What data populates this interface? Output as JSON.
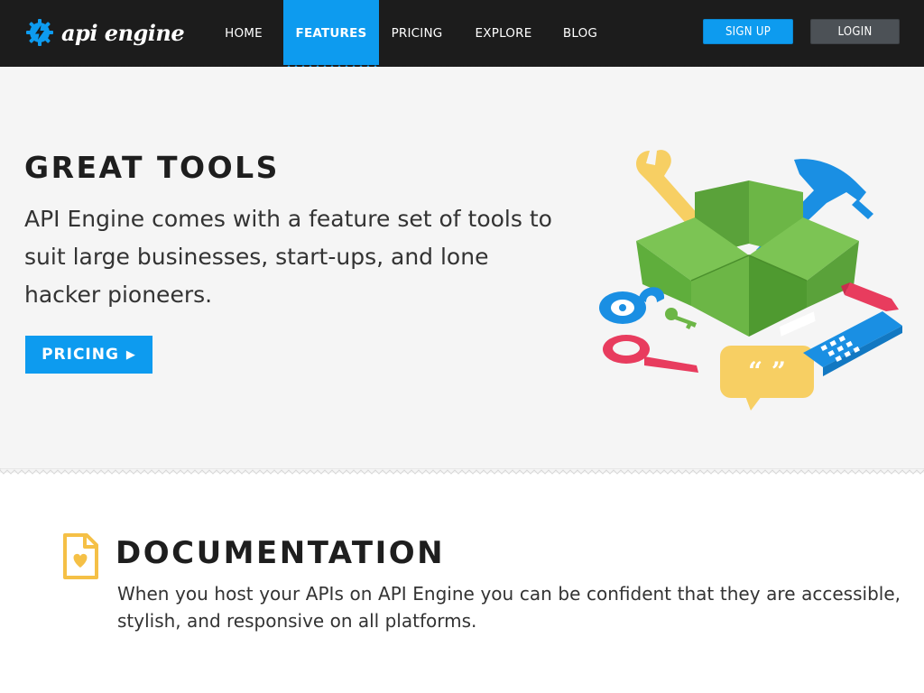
{
  "brand": {
    "name": "api engine",
    "logo_icon": "gear-bolt-icon",
    "color": "#0d9bef"
  },
  "nav": {
    "items": [
      {
        "label": "HOME",
        "active": false
      },
      {
        "label": "FEATURES",
        "active": true
      },
      {
        "label": "PRICING",
        "active": false
      },
      {
        "label": "EXPLORE",
        "active": false
      },
      {
        "label": "BLOG",
        "active": false
      }
    ],
    "signup_label": "SIGN UP",
    "login_label": "LOGIN"
  },
  "hero": {
    "title": "GREAT TOOLS",
    "text": "API Engine comes with a feature set of tools to suit large businesses, start-ups, and lone hacker pioneers.",
    "cta_label": "PRICING",
    "cta_icon": "play-arrow-icon",
    "illustration_icons": [
      "box-icon",
      "wrench-icon",
      "hammer-icon",
      "pencil-icon",
      "lock-icon",
      "key-icon",
      "magnifier-icon",
      "quote-bubble-icon",
      "phone-icon"
    ]
  },
  "documentation": {
    "icon": "document-heart-icon",
    "title": "DOCUMENTATION",
    "text": "When you host your APIs on API Engine you can be confident that they are accessible, stylish, and responsive on all platforms."
  },
  "colors": {
    "nav_bg": "#1c1c1c",
    "accent": "#0d9bef",
    "login_bg": "#4c5156",
    "hero_bg": "#f5f5f5",
    "box_green": "#6cb646",
    "wrench_yellow": "#f7cf63",
    "hammer_blue": "#1a8fe3",
    "red": "#e83c5e"
  }
}
